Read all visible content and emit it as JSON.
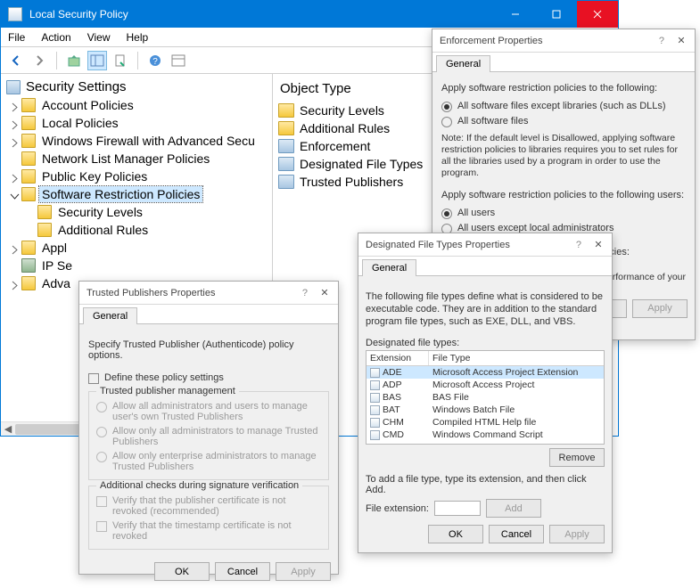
{
  "mainWindow": {
    "title": "Local Security Policy",
    "menu": [
      "File",
      "Action",
      "View",
      "Help"
    ],
    "tree": {
      "root": "Security Settings",
      "items": [
        {
          "label": "Account Policies"
        },
        {
          "label": "Local Policies"
        },
        {
          "label": "Windows Firewall with Advanced Secu"
        },
        {
          "label": "Network List Manager Policies"
        },
        {
          "label": "Public Key Policies"
        },
        {
          "label": "Software Restriction Policies"
        },
        {
          "label": "Security Levels"
        },
        {
          "label": "Additional Rules"
        },
        {
          "label": "Appl"
        },
        {
          "label": "IP Se"
        },
        {
          "label": "Adva"
        }
      ]
    },
    "list": {
      "header": "Object Type",
      "items": [
        {
          "label": "Security Levels"
        },
        {
          "label": "Additional Rules"
        },
        {
          "label": "Enforcement"
        },
        {
          "label": "Designated File Types"
        },
        {
          "label": "Trusted Publishers"
        }
      ]
    }
  },
  "enforce": {
    "title": "Enforcement Properties",
    "tab": "General",
    "p1": "Apply software restriction policies to the following:",
    "r1": "All software files except libraries (such as DLLs)",
    "r2": "All software files",
    "note": "Note: If the default level is Disallowed, applying software restriction policies to libraries requires you to set rules for all the libraries used by a program in order to use the program.",
    "p2": "Apply software restriction policies to the following users:",
    "r3": "All users",
    "r4": "All users except local administrators",
    "p3": "When applying software restriction policies:",
    "trail": "erformance of your",
    "apply": "Apply",
    "elBtn": "el"
  },
  "tp": {
    "title": "Trusted Publishers Properties",
    "help": "?",
    "tab": "General",
    "intro": "Specify Trusted Publisher (Authenticode) policy options.",
    "define": "Define these policy settings",
    "g1": "Trusted publisher management",
    "r1": "Allow all administrators and users to manage user's own Trusted Publishers",
    "r2": "Allow only all administrators to manage Trusted Publishers",
    "r3": "Allow only enterprise administrators to manage Trusted Publishers",
    "g2": "Additional checks during signature verification",
    "c1": "Verify that the publisher certificate is not revoked (recommended)",
    "c2": "Verify that the timestamp certificate is not revoked",
    "ok": "OK",
    "cancel": "Cancel",
    "apply": "Apply"
  },
  "dft": {
    "title": "Designated File Types Properties",
    "help": "?",
    "tab": "General",
    "intro": "The following file types define what is considered to be executable code. They are in addition to the standard program file types, such as EXE, DLL, and VBS.",
    "listLabel": "Designated file types:",
    "colExt": "Extension",
    "colType": "File Type",
    "rows": [
      {
        "ext": "ADE",
        "type": "Microsoft Access Project Extension"
      },
      {
        "ext": "ADP",
        "type": "Microsoft Access Project"
      },
      {
        "ext": "BAS",
        "type": "BAS File"
      },
      {
        "ext": "BAT",
        "type": "Windows Batch File"
      },
      {
        "ext": "CHM",
        "type": "Compiled HTML Help file"
      },
      {
        "ext": "CMD",
        "type": "Windows Command Script"
      }
    ],
    "remove": "Remove",
    "addText": "To add a file type, type its extension, and then click Add.",
    "extLabel": "File extension:",
    "add": "Add",
    "ok": "OK",
    "cancel": "Cancel",
    "apply": "Apply"
  }
}
